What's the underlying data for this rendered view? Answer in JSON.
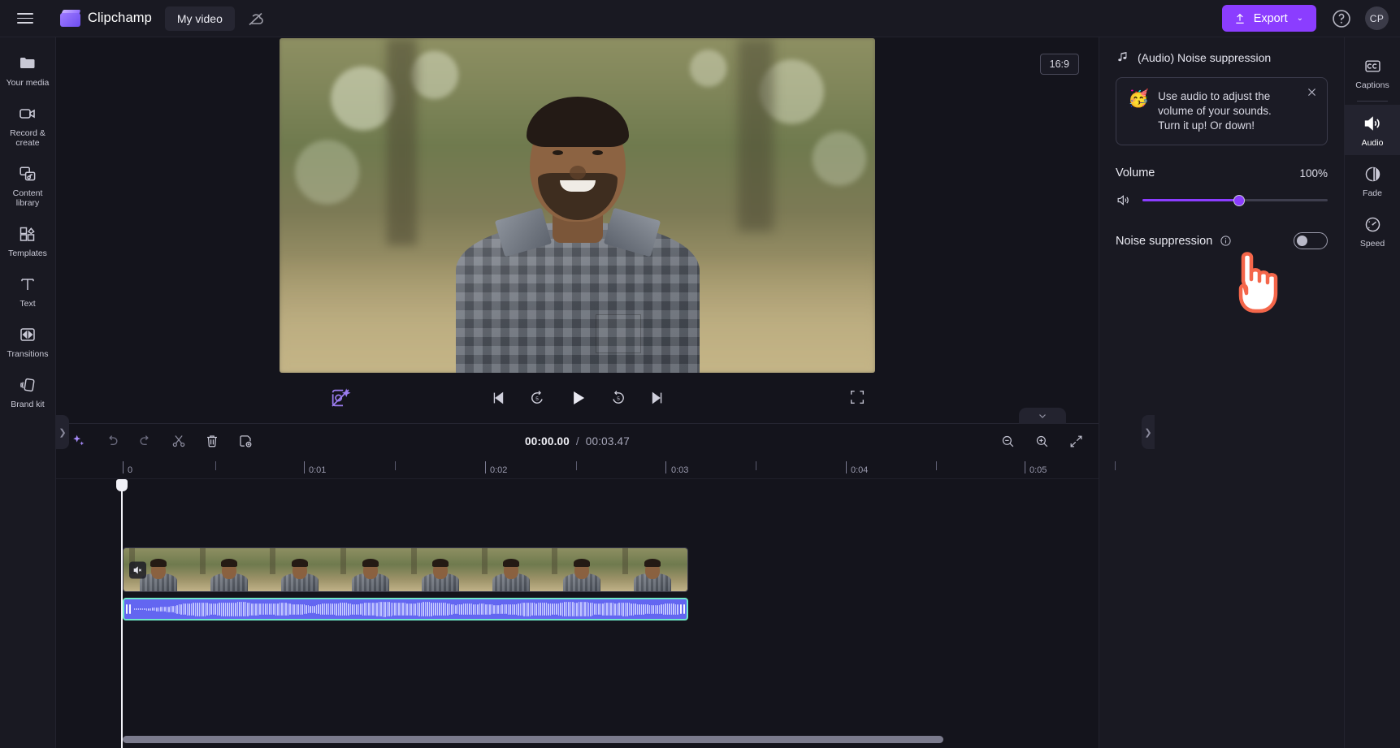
{
  "topbar": {
    "menu_icon": "hamburger-icon",
    "brand": "Clipchamp",
    "project_name": "My video",
    "cloud_icon": "cloud-off-icon",
    "export_label": "Export",
    "export_chevron": "⌄",
    "help_icon": "help-circle-icon",
    "avatar_initials": "CP",
    "accent_color": "#8b3dff"
  },
  "left_rail": {
    "items": [
      {
        "label": "Your media",
        "icon": "folder-icon"
      },
      {
        "label": "Record & create",
        "icon": "video-camera-icon"
      },
      {
        "label": "Content library",
        "icon": "content-library-icon"
      },
      {
        "label": "Templates",
        "icon": "templates-grid-icon"
      },
      {
        "label": "Text",
        "icon": "text-t-icon"
      },
      {
        "label": "Transitions",
        "icon": "transitions-icon"
      },
      {
        "label": "Brand kit",
        "icon": "brand-kit-icon"
      }
    ],
    "collapse_icon": "chevron-right-icon"
  },
  "stage": {
    "aspect_ratio": "16:9",
    "effects_icon": "magic-eraser-icon"
  },
  "transport": {
    "buttons": [
      {
        "name": "skip-to-start",
        "icon": "skip-start-icon"
      },
      {
        "name": "back-5s",
        "icon": "rewind-5-icon"
      },
      {
        "name": "play",
        "icon": "play-icon"
      },
      {
        "name": "forward-5s",
        "icon": "forward-5-icon"
      },
      {
        "name": "skip-to-end",
        "icon": "skip-end-icon"
      }
    ],
    "fullscreen_icon": "fullscreen-icon",
    "collapse_timeline_icon": "chevron-down-icon"
  },
  "timeline": {
    "tools": [
      {
        "name": "ai-suggestions",
        "icon": "sparkle-icon"
      },
      {
        "name": "undo",
        "icon": "undo-arrow-icon"
      },
      {
        "name": "redo",
        "icon": "redo-arrow-icon"
      },
      {
        "name": "split",
        "icon": "scissors-icon"
      },
      {
        "name": "delete",
        "icon": "trash-icon"
      },
      {
        "name": "duplicate",
        "icon": "duplicate-icon"
      }
    ],
    "current_time": "00:00.00",
    "separator": "/",
    "total_time": "00:03.47",
    "zoom_controls": [
      {
        "name": "zoom-out",
        "icon": "magnifier-minus-icon"
      },
      {
        "name": "zoom-in",
        "icon": "magnifier-plus-icon"
      },
      {
        "name": "zoom-to-fit",
        "icon": "fit-arrows-icon"
      }
    ],
    "ruler_labels": [
      "0",
      "0:01",
      "0:02",
      "0:03",
      "0:04",
      "0:05"
    ],
    "clip_mute_icon": "speaker-mute-icon",
    "video_clip_name": "video-clip",
    "audio_clip_name": "audio-clip"
  },
  "right_panel": {
    "header_icon": "music-note-icon",
    "header_title": "(Audio) Noise suppression",
    "callout": {
      "emoji": "🥳",
      "text": "Use audio to adjust the volume of your sounds. Turn it up! Or down!",
      "close_icon": "close-x-icon"
    },
    "volume": {
      "label": "Volume",
      "value": "100%",
      "speaker_icon": "speaker-icon",
      "slider_percent": 52
    },
    "noise_suppression": {
      "label": "Noise suppression",
      "info_icon": "info-circle-icon",
      "toggle_state": "off"
    },
    "cursor_icon": "pointing-hand-cursor"
  },
  "right_rail": {
    "items": [
      {
        "label": "Captions",
        "icon": "closed-captions-icon",
        "active": false
      },
      {
        "label": "Audio",
        "icon": "speaker-icon",
        "active": true
      },
      {
        "label": "Fade",
        "icon": "fade-circle-icon",
        "active": false
      },
      {
        "label": "Speed",
        "icon": "speedometer-icon",
        "active": false
      }
    ]
  }
}
